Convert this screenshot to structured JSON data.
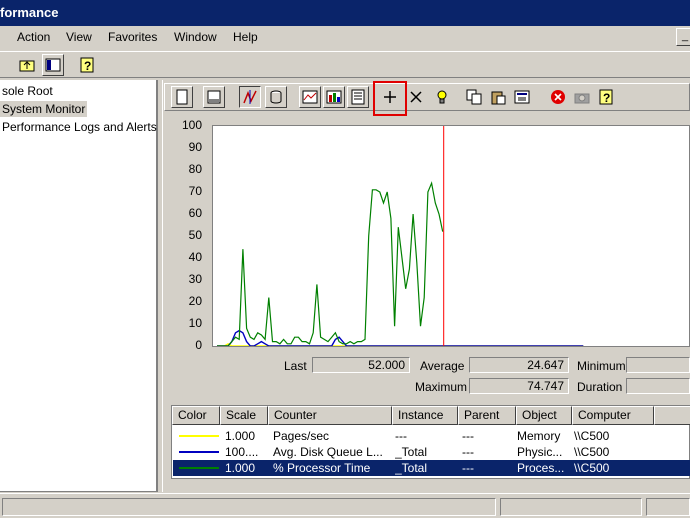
{
  "window": {
    "title": "formance"
  },
  "menu": {
    "items": [
      "Action",
      "View",
      "Favorites",
      "Window",
      "Help"
    ]
  },
  "tree": {
    "items": [
      "sole Root",
      "System Monitor",
      "Performance Logs and Alerts"
    ]
  },
  "graph": {
    "y_ticks": [
      "100",
      "90",
      "80",
      "70",
      "60",
      "50",
      "40",
      "30",
      "20",
      "10",
      "0"
    ],
    "colors": {
      "pages": "#ffff00",
      "disk": "#0000c0",
      "processor": "#008000",
      "time_bar": "#ff0000"
    }
  },
  "chart_data": {
    "type": "line",
    "ylim": [
      0,
      100
    ],
    "grid": false,
    "series": [
      {
        "name": "Pages/sec",
        "values": [
          0,
          0,
          0,
          1,
          0,
          0,
          0,
          0,
          0,
          0,
          0,
          0,
          0,
          0,
          0,
          0,
          0,
          0,
          0,
          0,
          0,
          0,
          0,
          0,
          0,
          0,
          0,
          0,
          0,
          0,
          0,
          0,
          0,
          0,
          0,
          0,
          0,
          0,
          0,
          0,
          0,
          0,
          0,
          0,
          0,
          0,
          0,
          0,
          0,
          0,
          0,
          0,
          0,
          0,
          0,
          0,
          0,
          0,
          0,
          0,
          0,
          0,
          0,
          0,
          0,
          0,
          0,
          0,
          0,
          0,
          0,
          0,
          0,
          0,
          0,
          0,
          0,
          0,
          0,
          0,
          0,
          0,
          0,
          0,
          0,
          0,
          0,
          0,
          0,
          0,
          0,
          0,
          0,
          0,
          0,
          0,
          0,
          0,
          0,
          0
        ]
      },
      {
        "name": "Avg. Disk Queue Length",
        "values": [
          0,
          0,
          0,
          0,
          2,
          6,
          7,
          6,
          2,
          0,
          0,
          1,
          2,
          1,
          0,
          0,
          0,
          0,
          0,
          0,
          0,
          0,
          0,
          0,
          0,
          0,
          0,
          0,
          0,
          0,
          0,
          0,
          3,
          4,
          2,
          0,
          0,
          0,
          0,
          0,
          0,
          0,
          0,
          0,
          0,
          0,
          0,
          0,
          0,
          0,
          0,
          0,
          0,
          0,
          0,
          0,
          0,
          0,
          0,
          0,
          0,
          0,
          0,
          0,
          0,
          0,
          0,
          0,
          0,
          0,
          0,
          0,
          0,
          0,
          0,
          0,
          0,
          0,
          0,
          0,
          0,
          0,
          0,
          0,
          0,
          0,
          0,
          0,
          0,
          0,
          0,
          0,
          0,
          0,
          0,
          0,
          0,
          0,
          0,
          0
        ]
      },
      {
        "name": "% Processor Time",
        "values": [
          0,
          0,
          0,
          0,
          2,
          4,
          3,
          44,
          8,
          4,
          3,
          6,
          5,
          3,
          22,
          2,
          2,
          1,
          3,
          1,
          1,
          4,
          4,
          2,
          2,
          1,
          6,
          28,
          4,
          3,
          2,
          4,
          6,
          2,
          1,
          1,
          2,
          1,
          2,
          2,
          3,
          50,
          71,
          71,
          70,
          65,
          70,
          58,
          9,
          54,
          40,
          26,
          35,
          60,
          38,
          9,
          22,
          70,
          74,
          65,
          60,
          52
        ]
      }
    ]
  },
  "stats": {
    "last_label": "Last",
    "last_value": "52.000",
    "average_label": "Average",
    "average_value": "24.647",
    "minimum_label": "Minimum",
    "minimum_value": "",
    "maximum_label": "Maximum",
    "maximum_value": "74.747",
    "duration_label": "Duration",
    "duration_value": ""
  },
  "legend": {
    "headers": [
      "Color",
      "Scale",
      "Counter",
      "Instance",
      "Parent",
      "Object",
      "Computer"
    ],
    "rows": [
      {
        "color": "#ffff00",
        "scale": "1.000",
        "counter": "Pages/sec",
        "instance": "---",
        "parent": "---",
        "object": "Memory",
        "computer": "\\\\C500"
      },
      {
        "color": "#0000c0",
        "scale": "100....",
        "counter": "Avg. Disk Queue L...",
        "instance": "_Total",
        "parent": "---",
        "object": "Physic...",
        "computer": "\\\\C500"
      },
      {
        "color": "#008000",
        "scale": "1.000",
        "counter": "% Processor Time",
        "instance": "_Total",
        "parent": "---",
        "object": "Proces...",
        "computer": "\\\\C500"
      }
    ]
  }
}
